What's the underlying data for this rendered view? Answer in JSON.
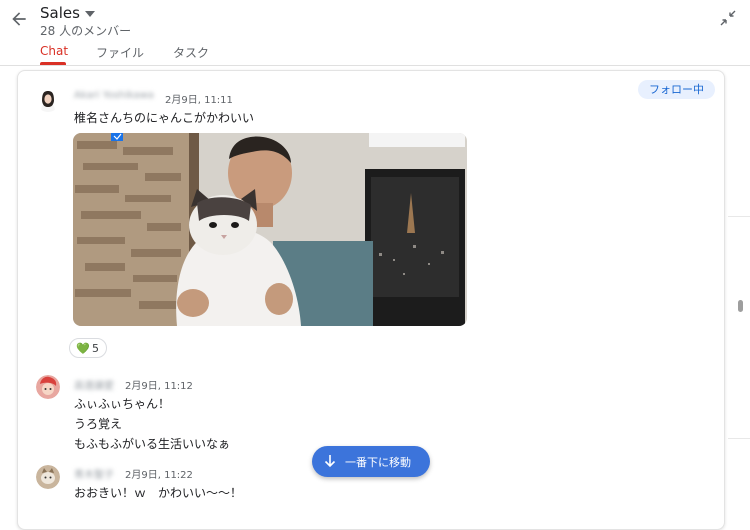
{
  "header": {
    "title": "Sales",
    "member_count": "28 人のメンバー",
    "tabs": [
      {
        "label": "Chat",
        "active": true
      },
      {
        "label": "ファイル",
        "active": false
      },
      {
        "label": "タスク",
        "active": false
      }
    ],
    "accent_color": "#d93025"
  },
  "thread": {
    "follow_label": "フォロー中"
  },
  "messages": [
    {
      "sender": "Akari Yoshikawa",
      "time": "2月9日, 11:11",
      "lines": [
        "椎名さんちのにゃんこがかわいい"
      ],
      "attachment": "photo-of-man-holding-cat",
      "reaction": {
        "emoji": "💚",
        "count": "5"
      }
    },
    {
      "sender": "高遠譲愛",
      "time": "2月9日, 11:12",
      "lines": [
        "ふぃふぃちゃん！",
        "うろ覚え",
        "もふもふがいる生活いいなぁ"
      ]
    },
    {
      "sender": "青木聖子",
      "time": "2月9日, 11:22",
      "lines": [
        "おおきい！ｗ　かわいい〜〜！"
      ]
    }
  ],
  "jump_to_bottom": {
    "label": "一番下に移動",
    "color": "#3c74db"
  },
  "icons": [
    "back-arrow-icon",
    "caret-down-icon",
    "collapse-icon",
    "arrow-down-icon"
  ]
}
